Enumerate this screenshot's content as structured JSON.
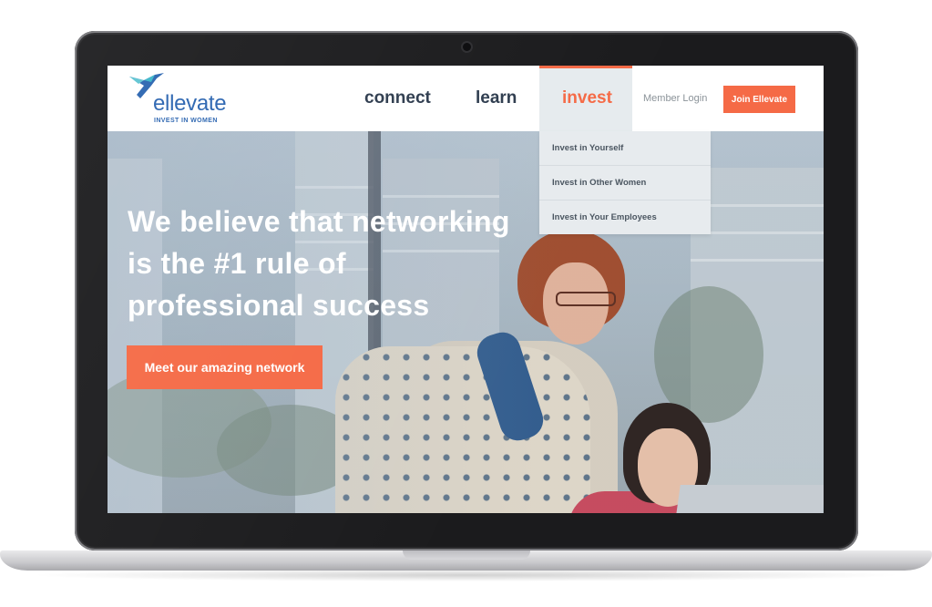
{
  "brand": {
    "name": "ellevate",
    "tagline": "INVEST IN WOMEN",
    "primary_color": "#2a64b0",
    "accent_color": "#f56a46"
  },
  "nav": {
    "items": [
      {
        "label": "connect"
      },
      {
        "label": "learn"
      },
      {
        "label": "invest",
        "active": true
      }
    ],
    "member_login": "Member Login",
    "join_button": "Join Ellevate"
  },
  "invest_menu": {
    "items": [
      {
        "label": "Invest in Yourself"
      },
      {
        "label": "Invest in Other Women"
      },
      {
        "label": "Invest in Your Employees"
      }
    ]
  },
  "hero": {
    "headline": "We believe that networking is the #1 rule of professional success",
    "cta_button": "Meet our amazing network"
  },
  "icons": {
    "logo": "hummingbird-logo-icon",
    "camera": "webcam-icon"
  }
}
